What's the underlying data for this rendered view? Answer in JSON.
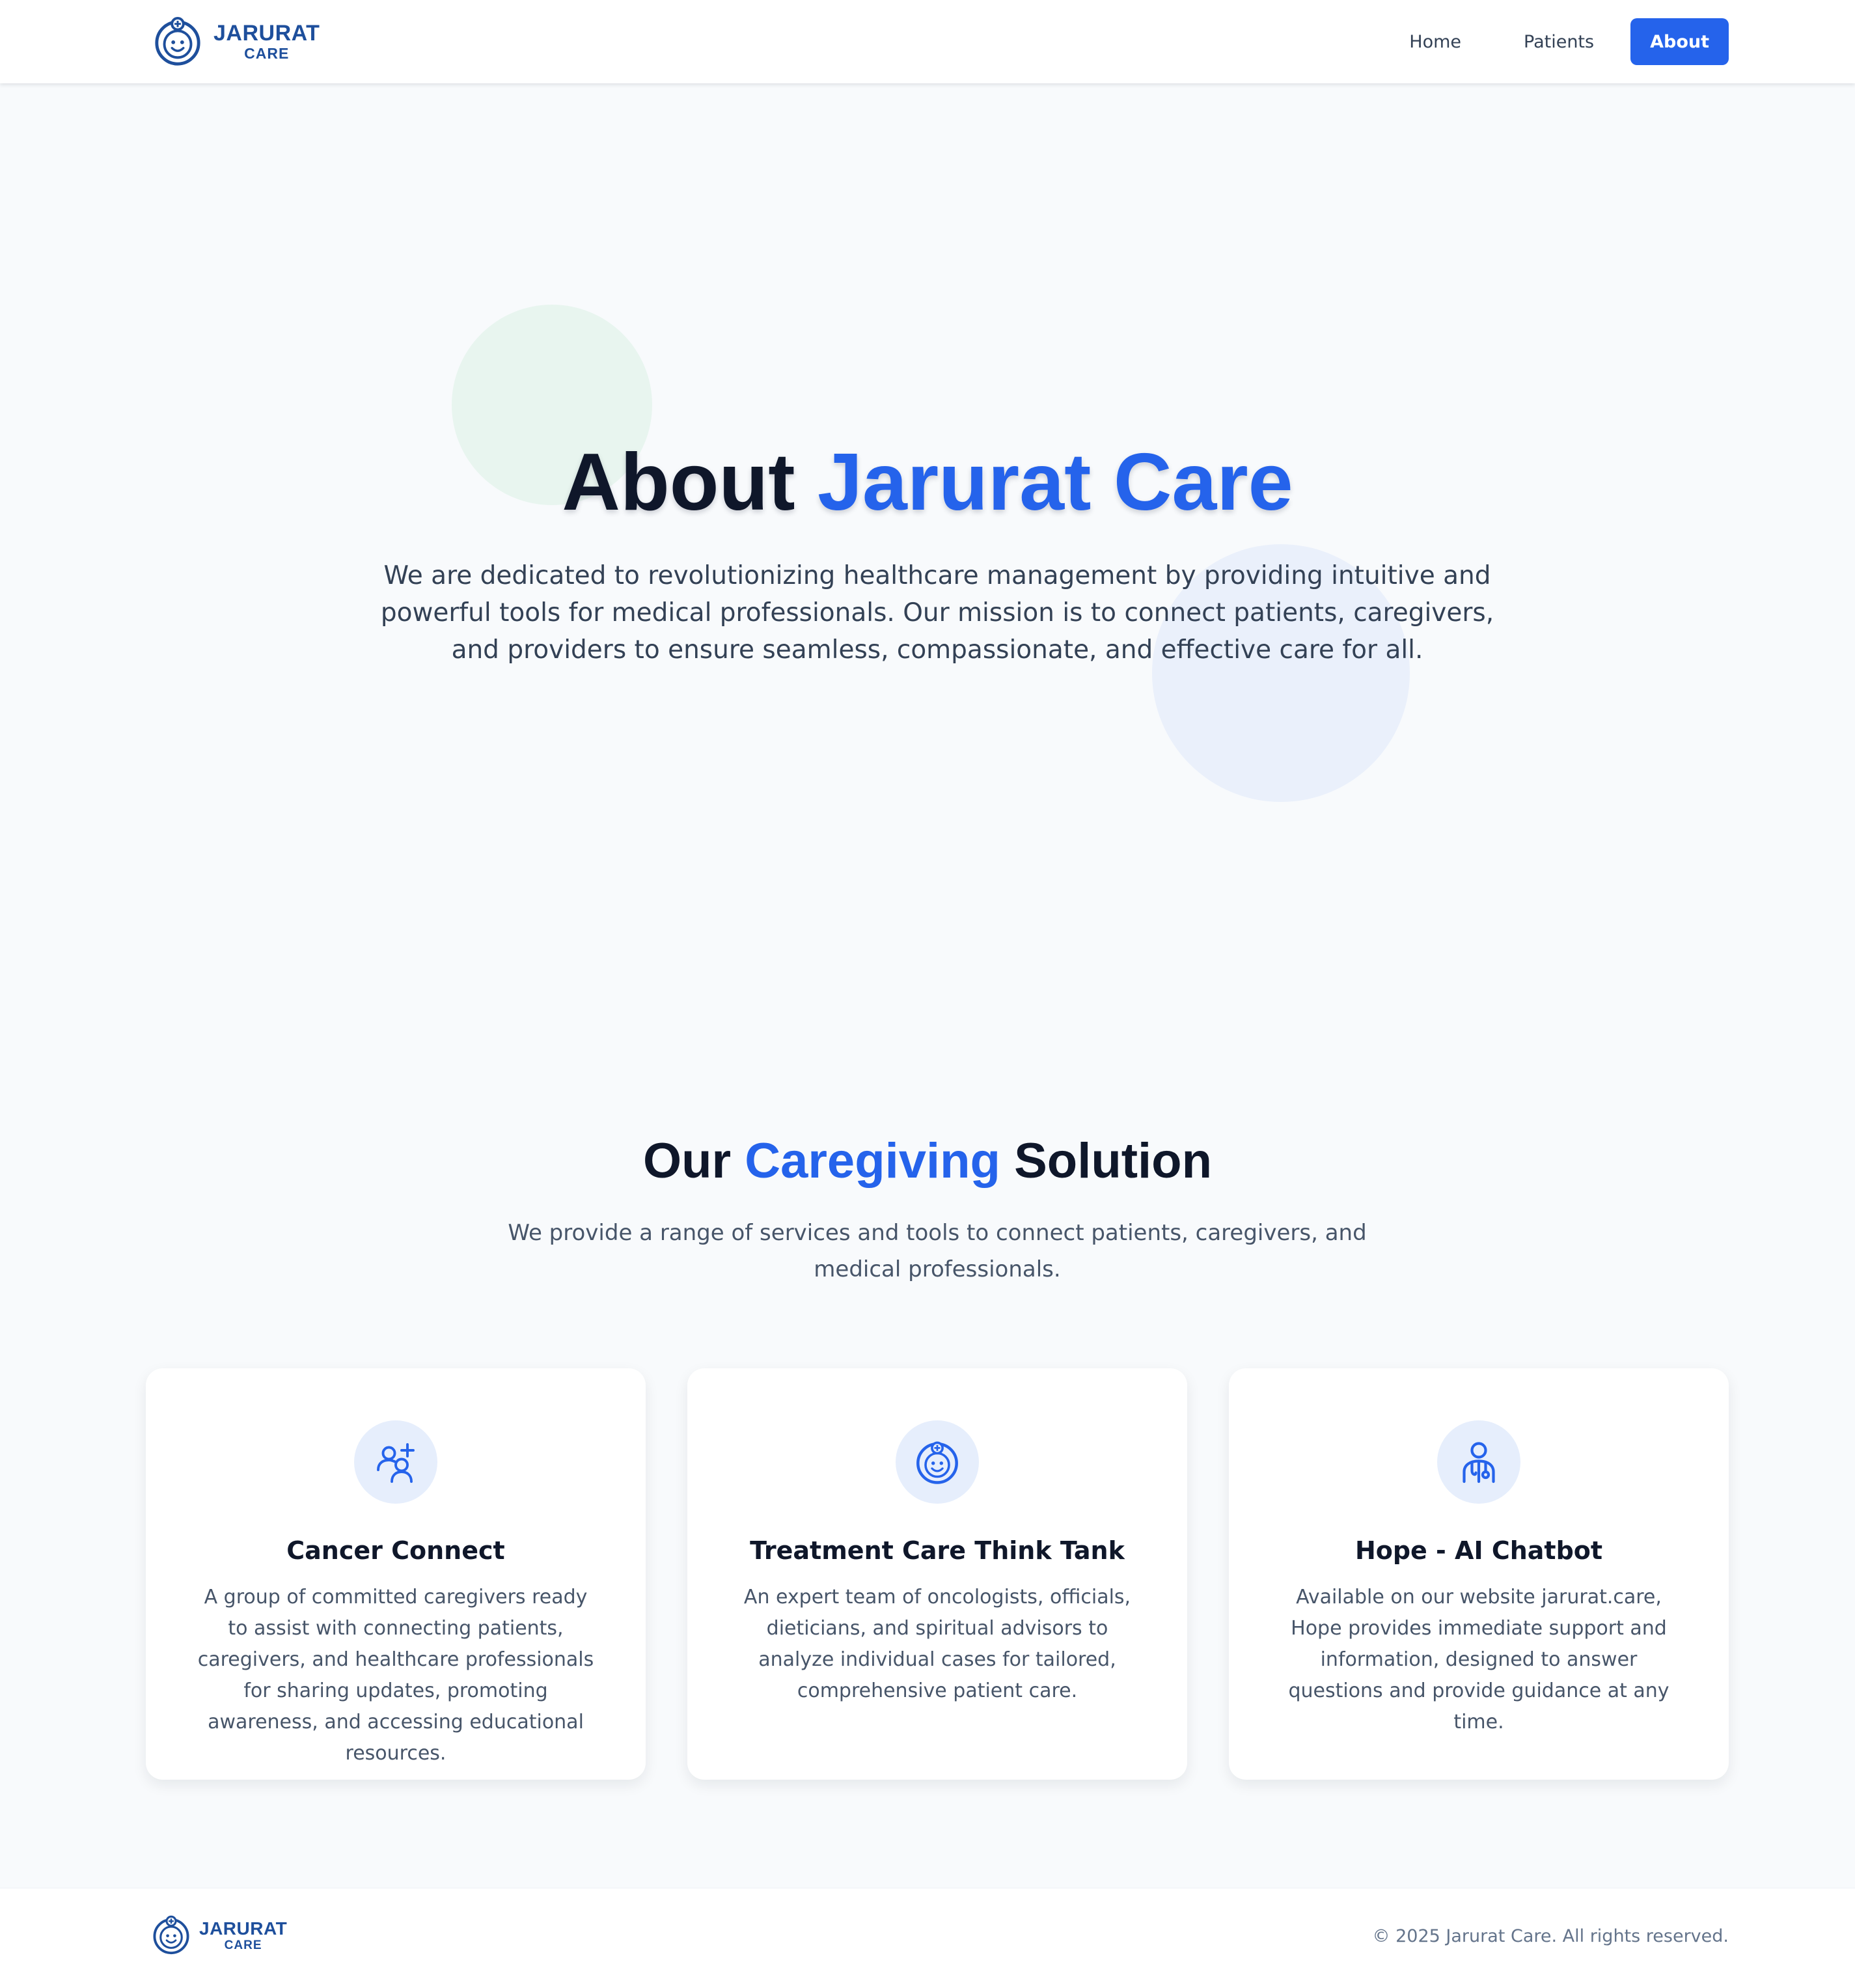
{
  "brand": {
    "name": "JARURAT",
    "sub": "CARE"
  },
  "nav": {
    "home": "Home",
    "patients": "Patients",
    "about": "About",
    "active": "about"
  },
  "hero": {
    "title_prefix": "About ",
    "title_accent": "Jarurat Care",
    "description": "We are dedicated to revolutionizing healthcare management by providing intuitive and powerful tools for medical professionals. Our mission is to connect patients, caregivers, and providers to ensure seamless, compassionate, and effective care for all."
  },
  "solutions": {
    "title_prefix": "Our ",
    "title_accent": "Caregiving",
    "title_suffix": " Solution",
    "description": "We provide a range of services and tools to connect patients, caregivers, and medical professionals.",
    "cards": [
      {
        "icon": "user-plus-group-icon",
        "title": "Cancer Connect",
        "description": "A group of committed caregivers ready to assist with connecting patients, caregivers, and healthcare professionals for sharing updates, promoting awareness, and accessing educational resources."
      },
      {
        "icon": "caregiver-face-icon",
        "title": "Treatment Care Think Tank",
        "description": "An expert team of oncologists, officials, dieticians, and spiritual advisors to analyze individual cases for tailored, comprehensive patient care."
      },
      {
        "icon": "doctor-stethoscope-icon",
        "title": "Hope - AI Chatbot",
        "description": "Available on our website jarurat.care, Hope provides immediate support and information, designed to answer questions and provide guidance at any time."
      }
    ]
  },
  "footer": {
    "copyright": "© 2025 Jarurat Care. All rights reserved."
  },
  "colors": {
    "accent": "#2563eb",
    "brand": "#1e4f9c",
    "background": "#f8fafc",
    "heading": "#0f172a",
    "body_text": "#475569"
  }
}
